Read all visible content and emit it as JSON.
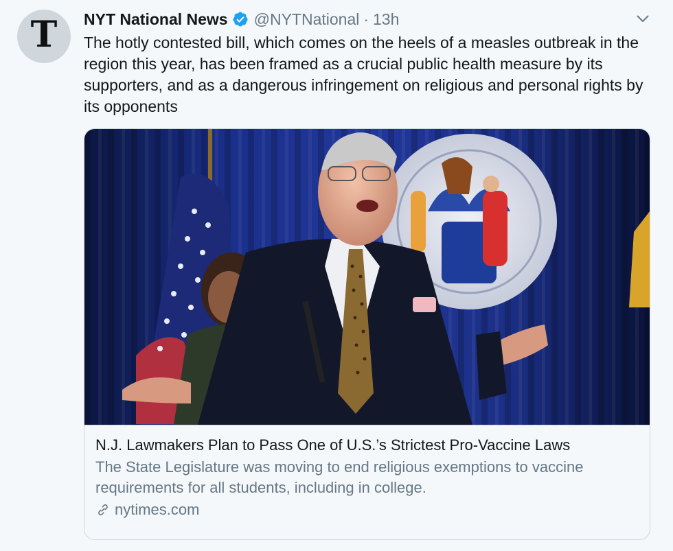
{
  "tweet": {
    "avatar_letter": "T",
    "display_name": "NYT National News",
    "handle": "@NYTNational",
    "separator": "·",
    "time": "13h",
    "text": "The hotly contested bill, which comes on the heels of a measles outbreak in the region this year, has been framed as a crucial public health measure by its supporters, and as a dangerous infringement on religious and personal rights by its opponents"
  },
  "card": {
    "title": "N.J. Lawmakers Plan to Pass One of U.S.’s Strictest Pro-Vaccine Laws",
    "description": "The State Legislature was moving to end religious exemptions to vaccine requirements for all students, including in college.",
    "domain": "nytimes.com"
  },
  "icons": {
    "verified": "verified-badge-icon",
    "chevron": "chevron-down-icon",
    "link": "link-icon"
  },
  "colors": {
    "verified": "#1da1f2",
    "secondary_text": "#657786",
    "border": "#ccd6dd",
    "background": "#f5f8fa"
  }
}
